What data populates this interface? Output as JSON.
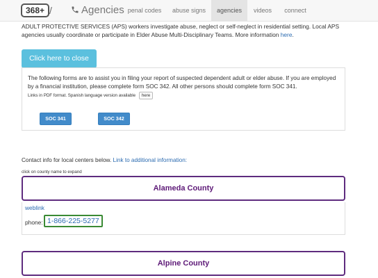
{
  "navbar": {
    "brand_badge": "368+",
    "brand_slash": "/",
    "brand_icon": "phone-icon",
    "title": "Agencies",
    "items": [
      {
        "label": "penal codes",
        "active": false
      },
      {
        "label": "abuse signs",
        "active": false
      },
      {
        "label": "agencies",
        "active": true
      },
      {
        "label": "videos",
        "active": false
      },
      {
        "label": "connect",
        "active": false
      }
    ]
  },
  "intro": {
    "text": "ADULT PROTECTIVE SERVICES (APS) workers investigate abuse, neglect or self-neglect in residential setting. Local APS agencies usually coordinate or participate in Elder Abuse Multi-Disciplinary Teams. More information",
    "link": "here",
    "after": "."
  },
  "close_button": "Click here to close",
  "forms_panel": {
    "text": "The following forms are to assist you in filing your report of suspected dependent adult or elder abuse. If you are employed by a financial institution, please complete form SOC 342. All other persons should complete form SOC 341.",
    "small_text": "Links in PDF format. Spanish language version available",
    "here_button": "here",
    "buttons": [
      "SOC 341",
      "SOC 342"
    ]
  },
  "contact": {
    "text": "Contact info for local centers below.",
    "link": "Link to additional information:"
  },
  "expand_note": "click on county name to expand",
  "counties": [
    {
      "name": "Alameda County",
      "expanded": true,
      "weblink": "weblink",
      "phone_label": "phone:",
      "phone": "1-866-225-5277"
    },
    {
      "name": "Alpine County",
      "expanded": false
    }
  ],
  "colors": {
    "info_button": "#5bc0de",
    "primary_button": "#428bca",
    "county_border": "#5e2b7e",
    "phone_border": "#3a8a34",
    "link": "#2a6ab0"
  }
}
